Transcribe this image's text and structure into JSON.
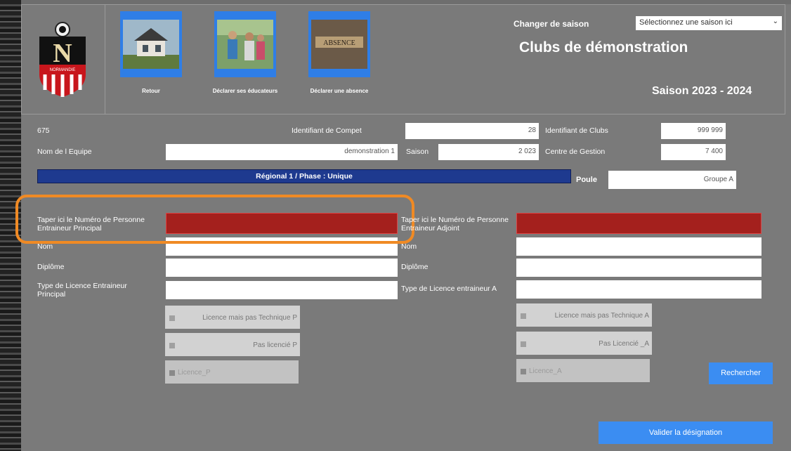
{
  "header": {
    "nav": [
      {
        "label": "Retour",
        "icon": "house-photo-icon"
      },
      {
        "label": "Déclarer ses éducateurs",
        "icon": "coaches-photo-icon"
      },
      {
        "label": "Déclarer une absence",
        "icon": "absence-tiles-icon"
      }
    ],
    "absence_tile_text": "ABSENCE",
    "season_switch_label": "Changer de saison",
    "season_select_value": "Sélectionnez une saison ici",
    "club_title": "Clubs de démonstration",
    "season_title": "Saison 2023 - 2024",
    "logo": {
      "letter": "N",
      "word": "NORMANDIE"
    }
  },
  "team": {
    "code": "675",
    "compet_id_label": "Identifiant de Compet",
    "compet_id_value": "28",
    "club_id_label": "Identifiant de Clubs",
    "club_id_value": "999 999",
    "team_name_label": "Nom de l Equipe",
    "team_name_value": "demonstration 1",
    "season_label": "Saison",
    "season_value": "2 023",
    "management_center_label": "Centre de Gestion",
    "management_center_value": "7 400",
    "division_banner": "Régional 1 / Phase : Unique",
    "pool_label": "Poule",
    "pool_value": "Groupe A"
  },
  "principal": {
    "person_number_label": "Taper ici le Numéro de Personne Entraineur Principal",
    "name_label": "Nom",
    "diploma_label": "Diplôme",
    "licence_type_label": "Type de Licence Entraineur Principal",
    "opt_licence_not_technical": "Licence mais pas Technique P",
    "opt_not_licensed": "Pas licencié P",
    "opt_licence": "Licence_P"
  },
  "assistant": {
    "person_number_label": "Taper ici le Numéro de Personne Entraineur Adjoint",
    "name_label": "Nom",
    "diploma_label": "Diplôme",
    "licence_type_label": "Type de Licence entraineur A",
    "opt_licence_not_technical": "Licence mais pas Technique A",
    "opt_not_licensed": "Pas Licencié _A",
    "opt_licence": "Licence_A"
  },
  "actions": {
    "search_label": "Rechercher",
    "validate_label": "Valider la désignation"
  },
  "colors": {
    "accent_blue": "#2f7ee6",
    "required_red": "#a4201d",
    "highlight_orange": "#f08a24",
    "banner_navy": "#1e3a8f"
  }
}
